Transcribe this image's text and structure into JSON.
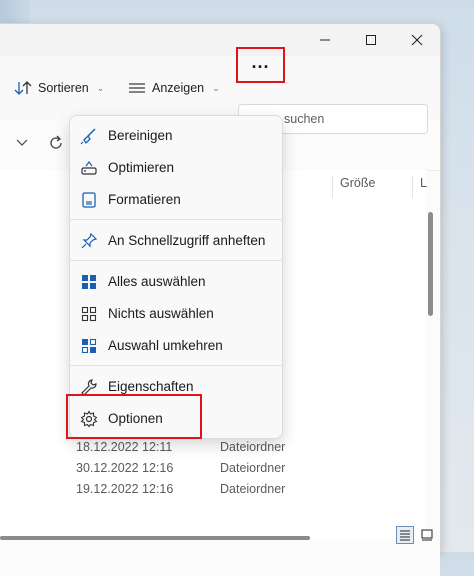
{
  "toolbar": {
    "sort_label": "Sortieren",
    "view_label": "Anzeigen",
    "more_label": "..."
  },
  "search": {
    "placeholder_fragment": "suchen"
  },
  "columns": {
    "size": "Größe",
    "overflow": "L"
  },
  "rows": [
    {
      "date": "18.12.2022 12:11",
      "type": "Dateiordner"
    },
    {
      "date": "30.12.2022 12:16",
      "type": "Dateiordner"
    },
    {
      "date": "19.12.2022 12:16",
      "type": "Dateiordner"
    }
  ],
  "menu": {
    "items": [
      {
        "label": "Bereinigen",
        "icon": "broom-icon"
      },
      {
        "label": "Optimieren",
        "icon": "optimize-drive-icon"
      },
      {
        "label": "Formatieren",
        "icon": "format-drive-icon"
      },
      {
        "label": "An Schnellzugriff anheften",
        "icon": "pin-icon"
      },
      {
        "label": "Alles auswählen",
        "icon": "select-all-icon"
      },
      {
        "label": "Nichts auswählen",
        "icon": "select-none-icon"
      },
      {
        "label": "Auswahl umkehren",
        "icon": "invert-selection-icon"
      },
      {
        "label": "Eigenschaften",
        "icon": "properties-wrench-icon"
      },
      {
        "label": "Optionen",
        "icon": "options-gear-icon"
      }
    ]
  },
  "colors": {
    "highlight_border": "#e0151b",
    "accent": "#1a5fb4"
  }
}
